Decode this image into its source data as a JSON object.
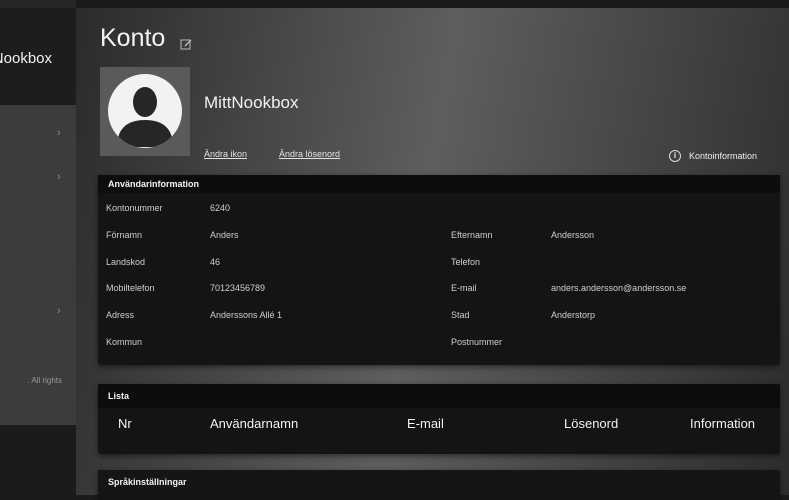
{
  "sidebar": {
    "brand_text": "Nookbox",
    "chevron": "›",
    "copyright_text": ". All rights"
  },
  "account": {
    "title": "Konto",
    "edit_icon": "edit-icon",
    "username": "MittNookbox",
    "change_icon_label": "Ändra ikon",
    "change_password_label": "Ändra lösenord",
    "info_label": "Kontoinformation"
  },
  "user_info": {
    "header": "Användarinformation",
    "account_number_label": "Kontonummer",
    "account_number": "6240",
    "first_name_label": "Förnamn",
    "first_name": "Anders",
    "last_name_label": "Efternamn",
    "last_name": "Andersson",
    "country_code_label": "Landskod",
    "country_code": "46",
    "phone_label": "Telefon",
    "phone": "",
    "mobile_label": "Mobiltelefon",
    "mobile": "70123456789",
    "email_label": "E-mail",
    "email": "anders.andersson@andersson.se",
    "address_label": "Adress",
    "address": "Anderssons Allé 1",
    "city_label": "Stad",
    "city": "Anderstorp",
    "municipality_label": "Kommun",
    "municipality": "",
    "postal_code_label": "Postnummer",
    "postal_code": ""
  },
  "list": {
    "header": "Lista",
    "columns": [
      "Nr",
      "Användarnamn",
      "E-mail",
      "Lösenord",
      "Information"
    ]
  },
  "language": {
    "header": "Språkinställningar"
  }
}
